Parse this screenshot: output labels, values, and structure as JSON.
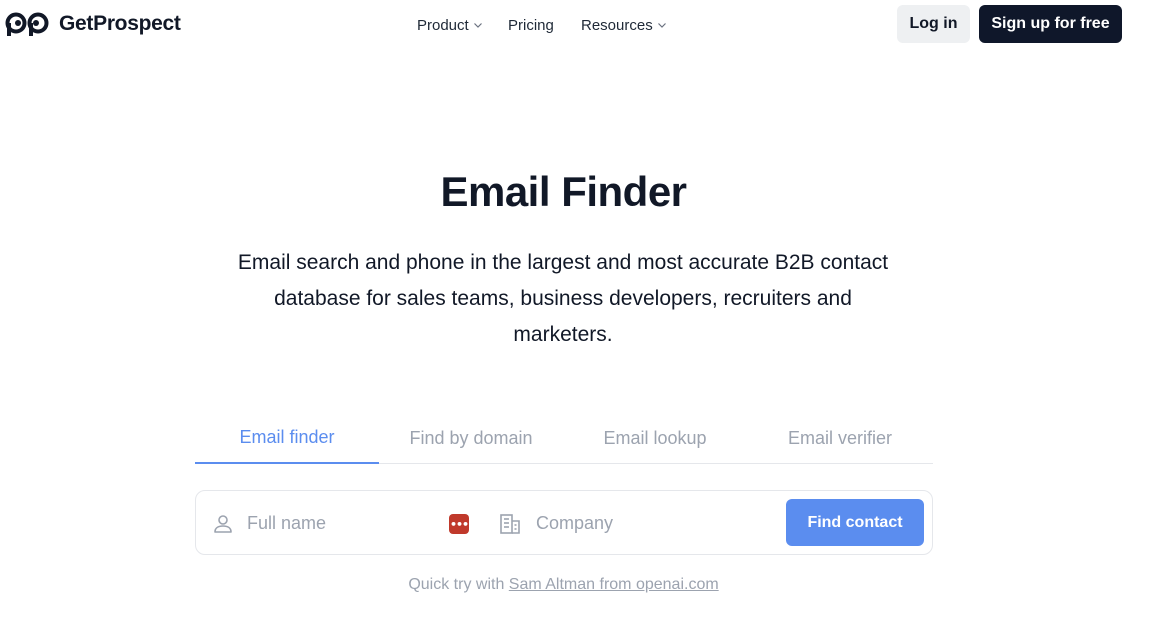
{
  "header": {
    "brand": "GetProspect",
    "nav": [
      {
        "label": "Product",
        "has_dropdown": true
      },
      {
        "label": "Pricing",
        "has_dropdown": false
      },
      {
        "label": "Resources",
        "has_dropdown": true
      }
    ],
    "login_label": "Log in",
    "signup_label": "Sign up for free"
  },
  "hero": {
    "title": "Email Finder",
    "subtitle": "Email search and phone in the largest and most accurate B2B contact database for sales teams, business developers, recruiters and marketers."
  },
  "tabs": [
    {
      "label": "Email finder",
      "active": true
    },
    {
      "label": "Find by domain",
      "active": false
    },
    {
      "label": "Email lookup",
      "active": false
    },
    {
      "label": "Email verifier",
      "active": false
    }
  ],
  "search": {
    "name_placeholder": "Full name",
    "name_value": "",
    "company_placeholder": "Company",
    "company_value": "",
    "password_manager_badge": "•••",
    "button_label": "Find contact"
  },
  "quick_try": {
    "prefix": "Quick try with ",
    "link": "Sam Altman from openai.com"
  },
  "colors": {
    "accent": "#5b8def",
    "dark_button": "#0f172a",
    "login_bg": "#eef0f2",
    "muted_text": "#9ca3af",
    "badge_red": "#c0392b"
  },
  "icons": {
    "logo": "owl-eyes-logo-icon",
    "dropdown": "chevron-down-icon",
    "name_field": "person-icon",
    "company_field": "building-icon",
    "password_manager": "password-manager-icon"
  }
}
